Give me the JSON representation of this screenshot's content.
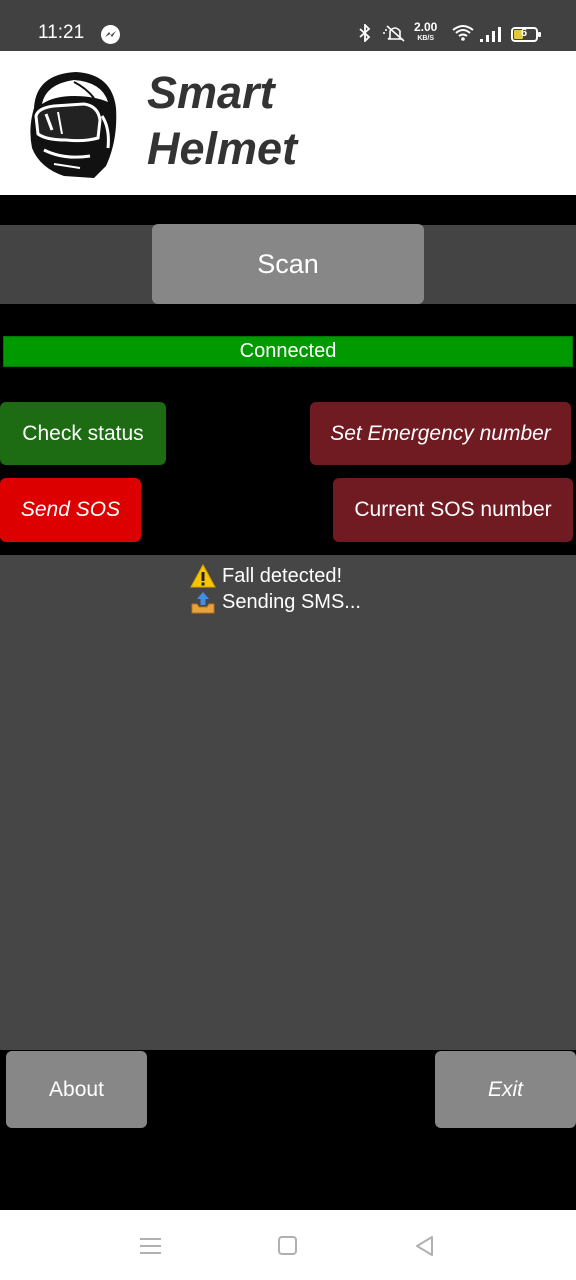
{
  "status_bar": {
    "time": "11:21",
    "network_speed": "2.00",
    "network_speed_unit": "KB/S",
    "battery_level": "6",
    "icons": [
      "messenger-icon",
      "bluetooth-icon",
      "mute-icon",
      "wifi-icon",
      "signal-icon",
      "battery-icon"
    ]
  },
  "header": {
    "title_line1": "Smart",
    "title_line2": "Helmet"
  },
  "scan": {
    "label": "Scan"
  },
  "connection": {
    "status": "Connected",
    "color": "#009900"
  },
  "actions": {
    "check_status": "Check status",
    "set_emergency": "Set Emergency number",
    "send_sos": "Send SOS",
    "current_sos": "Current SOS number"
  },
  "log": {
    "lines": [
      {
        "icon": "warning-icon",
        "text": "Fall detected!"
      },
      {
        "icon": "outbox-tray-icon",
        "text": "Sending SMS..."
      }
    ]
  },
  "footer": {
    "about": "About",
    "exit": "Exit"
  },
  "colors": {
    "check_green": "#1d6b12",
    "dark_red": "#701a22",
    "sos_red": "#dd0000",
    "gray_button": "#878787"
  }
}
